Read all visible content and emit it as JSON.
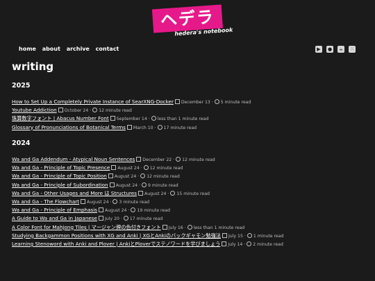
{
  "logo": {
    "text": "ヘデラ",
    "subtitle": "hedera's notebook"
  },
  "nav": {
    "home": "home",
    "about": "about",
    "archive": "archive",
    "contact": "contact"
  },
  "social": [
    "youtube-icon",
    "github-icon",
    "kofi-icon",
    "rss-icon"
  ],
  "page_title": "writing",
  "sections": [
    {
      "year": "2025",
      "posts": [
        {
          "title": "How to Set Up a Completely Private Instance of SearXNG-Docker",
          "date": "December 13",
          "read": "5 minute read"
        },
        {
          "title": "Youtube Addiction",
          "date": "October 24",
          "read": "12 minute read"
        },
        {
          "title": "珠算数字フォント | Abacus Number Font",
          "date": "September 14",
          "read": "less than 1 minute read"
        },
        {
          "title": "Glossary of Pronunciations of Botanical Terms",
          "date": "March 10",
          "read": "17 minute read"
        }
      ]
    },
    {
      "year": "2024",
      "posts": [
        {
          "title": "Wa and Ga Addendum - Atypical Noun Sentences",
          "date": "December 22",
          "read": "12 minute read"
        },
        {
          "title": "Wa and Ga - Principle of Topic Presence",
          "date": "August 24",
          "read": "12 minute read"
        },
        {
          "title": "Wa and Ga - Principle of Topic Position",
          "date": "August 24",
          "read": "12 minute read"
        },
        {
          "title": "Wa and Ga - Principle of Subordination",
          "date": "August 24",
          "read": "9 minute read"
        },
        {
          "title": "Wa and Ga - Other Usages and More は Structures",
          "date": "August 24",
          "read": "15 minute read"
        },
        {
          "title": "Wa and Ga - The Flowchart",
          "date": "August 24",
          "read": "3 minute read"
        },
        {
          "title": "Wa and Ga - Principle of Emphasis",
          "date": "August 24",
          "read": "19 minute read"
        },
        {
          "title": "A Guide to Wa and Ga in Japanese",
          "date": "July 20",
          "read": "17 minute read"
        },
        {
          "title": "A Color Font for Mahjong Tiles | マージャン牌の色付きフォント",
          "date": "July 16",
          "read": "less than 1 minute read"
        },
        {
          "title": "Studying Backgammon Positions with XG and Anki | XGとAnkiのバックギャモン勉強法",
          "date": "July 15",
          "read": "1 minute read"
        },
        {
          "title": "Learning Stenoword with Anki and Plover | AnkiとPloverでステノワードを学びましょう",
          "date": "July 14",
          "read": "2 minute read"
        }
      ]
    }
  ],
  "colors": {
    "background": "#1b1b1b",
    "accent": "#e6198a",
    "text": "#ffffff",
    "meta": "#bdbdbd"
  }
}
